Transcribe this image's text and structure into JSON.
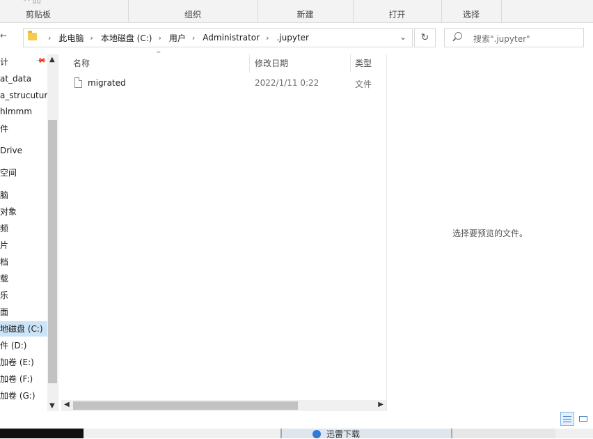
{
  "ribbon": {
    "groups": [
      "剪贴板",
      "组织",
      "新建",
      "打开",
      "选择"
    ]
  },
  "address": {
    "crumbs": [
      "此电脑",
      "本地磁盘 (C:)",
      "用户",
      "Administrator",
      ".jupyter"
    ],
    "search_placeholder": "搜索\".jupyter\""
  },
  "nav": {
    "items": [
      "计",
      "at_data",
      "a_strucuture",
      "hlmmm",
      "件",
      "Drive",
      "空间",
      "脑",
      "对象",
      "频",
      "片",
      "档",
      "载",
      "乐",
      "面",
      "地磁盘 (C:)",
      "件 (D:)",
      "加卷 (E:)",
      "加卷 (F:)",
      "加卷 (G:)"
    ]
  },
  "list": {
    "headers": {
      "name": "名称",
      "date": "修改日期",
      "type": "类型"
    },
    "rows": [
      {
        "name": "migrated",
        "date": "2022/1/11 0:22",
        "type": "文件"
      }
    ]
  },
  "preview": {
    "message": "选择要预览的文件。"
  },
  "taskbar": {
    "task_label": "迅雷下载"
  }
}
